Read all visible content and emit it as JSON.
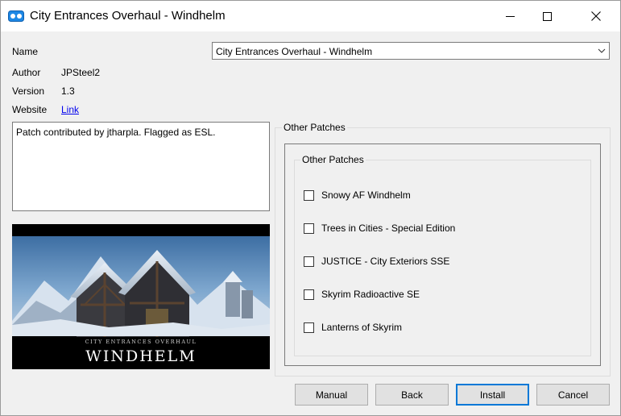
{
  "window": {
    "title": "City Entrances Overhaul - Windhelm"
  },
  "fields": {
    "name_label": "Name",
    "name_value": "City Entrances Overhaul - Windhelm",
    "author_label": "Author",
    "author_value": "JPSteel2",
    "version_label": "Version",
    "version_value": "1.3",
    "website_label": "Website",
    "website_link": "Link"
  },
  "description": "Patch contributed by jtharpla. Flagged as ESL.",
  "image": {
    "caption_small": "CITY ENTRANCES OVERHAUL",
    "caption_large": "WINDHELM"
  },
  "group": {
    "outer_title": "Other Patches",
    "inner_title": "Other Patches",
    "options": [
      {
        "label": "Snowy AF Windhelm",
        "checked": false
      },
      {
        "label": "Trees in Cities - Special Edition",
        "checked": false
      },
      {
        "label": "JUSTICE - City Exteriors SSE",
        "checked": false
      },
      {
        "label": "Skyrim Radioactive SE",
        "checked": false
      },
      {
        "label": "Lanterns of Skyrim",
        "checked": false
      }
    ]
  },
  "buttons": {
    "manual": "Manual",
    "back": "Back",
    "install": "Install",
    "cancel": "Cancel"
  },
  "colors": {
    "accent": "#0078d7",
    "link": "#0000ee"
  }
}
